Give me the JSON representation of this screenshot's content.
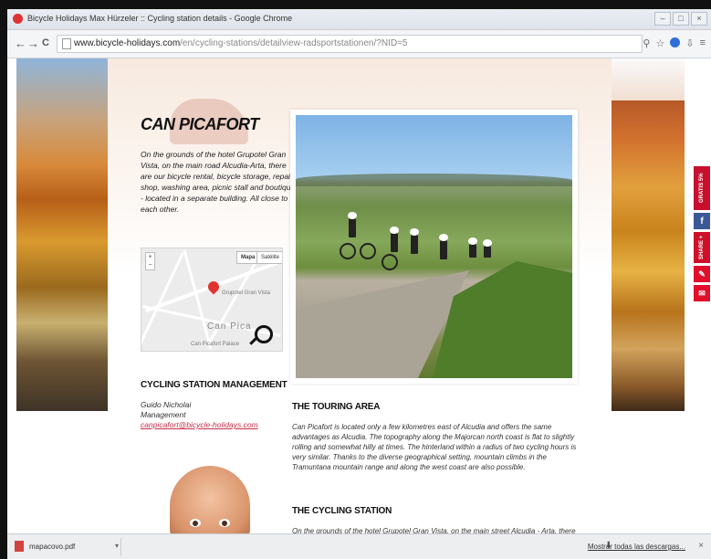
{
  "window": {
    "title": "Bicycle Holidays Max Hürzeler :: Cycling station details - Google Chrome",
    "buttons": [
      "–",
      "□",
      "×"
    ]
  },
  "toolbar": {
    "back": "←",
    "forward": "→",
    "reload": "C",
    "url_domain": "www.bicycle-holidays.com",
    "url_path": "/en/cycling-stations/detailview-radsportstationen/?NID=5"
  },
  "page": {
    "title": "CAN PICAFORT",
    "intro": "On the grounds of the hotel Grupotel Gran Vista, on the main road Alcudia-Arta, there are our bicycle rental, bicycle storage, repair shop, washing area, picnic stall and boutique - located in a separate building. All close to each other.",
    "map": {
      "tab_map": "Mapa",
      "tab_sat": "Satélite",
      "zoom_in": "+",
      "zoom_out": "−",
      "hotel_label": "Grupotel Gran Vista",
      "town_label": "Can Pica",
      "footer_label": "Can Picafort Palace"
    },
    "management": {
      "heading": "CYCLING STATION MANAGEMENT",
      "name": "Guido Nicholai",
      "role": "Management",
      "email": "canpicafort@bicycle-holidays.com"
    },
    "touring": {
      "heading": "THE TOURING AREA",
      "text": "Can Picafort is located only a few kilometres east of Alcudia and offers the same advantages as Alcudia. The topography along the Majorcan north coast is flat to slightly rolling and somewhat hilly at times. The hinterland within a radius of two cycling hours is very similar. Thanks to the diverse geographical setting, mountain climbs in the Tramuntana mountain range and along the west coast are also possible."
    },
    "station": {
      "heading": "THE CYCLING STATION",
      "text": "On the grounds of the hotel Grupotel Gran Vista, on the main street Alcudia - Arta, there is the"
    },
    "share": [
      {
        "label": "GRATIS 5%",
        "color": "#c8102e"
      },
      {
        "label": "f",
        "color": "#3b5998"
      },
      {
        "label": "SHARE +",
        "color": "#d0102a"
      },
      {
        "label": "✎",
        "color": "#e0102a"
      },
      {
        "label": "✉",
        "color": "#e0102a"
      }
    ]
  },
  "downloads": {
    "file": "mapacovo.pdf",
    "show_all": "Mostrar todas las descargas...",
    "close": "×"
  }
}
